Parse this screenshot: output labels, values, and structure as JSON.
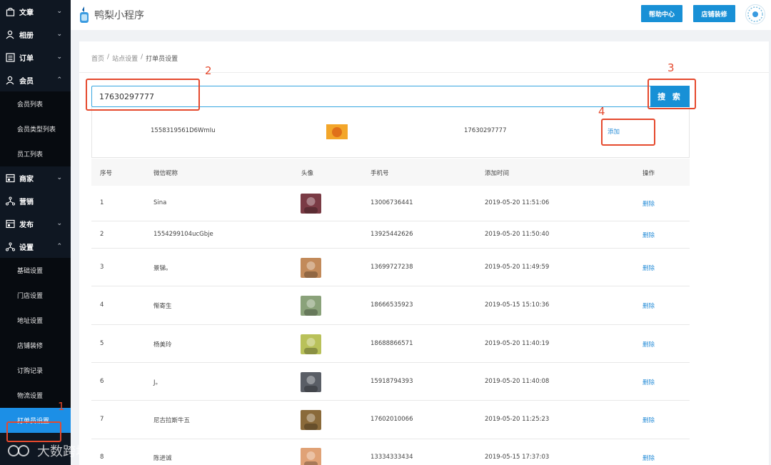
{
  "header": {
    "app_name": "鸭梨小程序",
    "help_label": "帮助中心",
    "decorate_label": "店铺装修"
  },
  "sidebar": {
    "menu": [
      {
        "label": "文章",
        "icon": "bag-icon",
        "arrow": "⌄"
      },
      {
        "label": "相册",
        "icon": "user-icon",
        "arrow": "⌄"
      },
      {
        "label": "订单",
        "icon": "list-icon",
        "arrow": "⌄"
      },
      {
        "label": "会员",
        "icon": "user-icon",
        "arrow": "⌃"
      }
    ],
    "member_sub": [
      "会员列表",
      "会员类型列表",
      "员工列表"
    ],
    "menu2": [
      {
        "label": "商家",
        "icon": "store-icon",
        "arrow": "⌄"
      },
      {
        "label": "营销",
        "icon": "share-icon",
        "arrow": ""
      },
      {
        "label": "发布",
        "icon": "store-icon",
        "arrow": "⌄"
      },
      {
        "label": "设置",
        "icon": "share-icon",
        "arrow": "⌃"
      }
    ],
    "settings_sub": [
      "基础设置",
      "门店设置",
      "地址设置",
      "店铺装修",
      "订购记录",
      "物流设置",
      "打单员设置"
    ]
  },
  "breadcrumb": {
    "home": "首页",
    "sep": "/",
    "site": "站点设置",
    "current": "打单员设置"
  },
  "search": {
    "value": "17630297777",
    "button": "搜 索"
  },
  "result": {
    "nickname": "1558319561D6WmIu",
    "phone": "17630297777",
    "add_label": "添加"
  },
  "annotations": [
    "1",
    "2",
    "3",
    "4"
  ],
  "table": {
    "headers": [
      "序号",
      "微信昵称",
      "头像",
      "手机号",
      "添加时间",
      "操作"
    ],
    "rows": [
      {
        "no": "1",
        "nickname": "Sina",
        "phone": "13006736441",
        "time": "2019-05-20 11:51:06",
        "action": "删除",
        "avatar": "#7a3b45"
      },
      {
        "no": "2",
        "nickname": "1554299104ucGbje",
        "phone": "13925442626",
        "time": "2019-05-20 11:50:40",
        "action": "删除",
        "avatar": ""
      },
      {
        "no": "3",
        "nickname": "景锑。",
        "phone": "13699727238",
        "time": "2019-05-20 11:49:59",
        "action": "删除",
        "avatar": "#c28a5a"
      },
      {
        "no": "4",
        "nickname": "惭寄生",
        "phone": "18666535923",
        "time": "2019-05-15 15:10:36",
        "action": "删除",
        "avatar": "#8aa27a"
      },
      {
        "no": "5",
        "nickname": "杨美玲",
        "phone": "18688866571",
        "time": "2019-05-20 11:40:19",
        "action": "删除",
        "avatar": "#b9c15a"
      },
      {
        "no": "6",
        "nickname": "J。",
        "phone": "15918794393",
        "time": "2019-05-20 11:40:08",
        "action": "删除",
        "avatar": "#5a5e66"
      },
      {
        "no": "7",
        "nickname": "尼古拉斯牛五",
        "phone": "17602010066",
        "time": "2019-05-20 11:25:23",
        "action": "删除",
        "avatar": "#8a6a3a"
      },
      {
        "no": "8",
        "nickname": "陈进诚",
        "phone": "13334333434",
        "time": "2019-05-15 17:37:03",
        "action": "删除",
        "avatar": "#e0a276"
      }
    ]
  },
  "watermark": "大数跨境",
  "colors": {
    "accent": "#1890d6",
    "annotation": "#e5492d",
    "sidebar": "#0f1722"
  }
}
